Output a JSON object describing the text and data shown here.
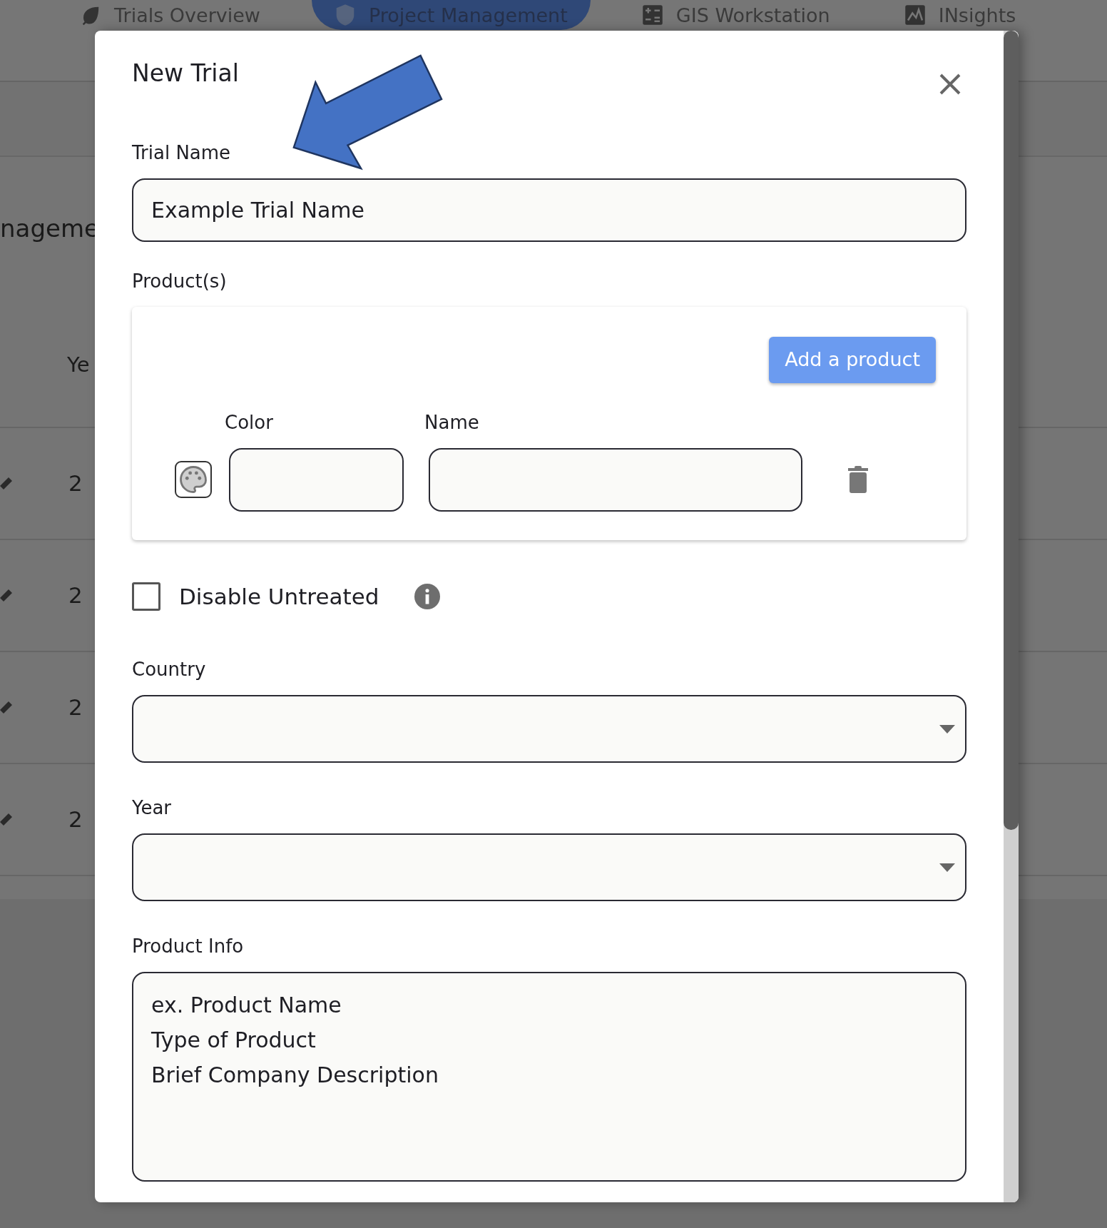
{
  "nav": {
    "tabs": [
      {
        "label": "Trials Overview",
        "selected": false
      },
      {
        "label": "Project Management",
        "selected": true
      },
      {
        "label": "GIS Workstation",
        "selected": false
      },
      {
        "label": "INsights",
        "selected": false
      }
    ]
  },
  "background": {
    "heading": "nageme",
    "column_header": "Ye",
    "rows": [
      {
        "cell": "2"
      },
      {
        "cell": "2"
      },
      {
        "cell": "2"
      },
      {
        "cell": "2"
      }
    ]
  },
  "modal": {
    "title": "New Trial",
    "trial_name": {
      "label": "Trial Name",
      "value": "Example Trial Name"
    },
    "products": {
      "label": "Product(s)",
      "add_button": "Add a product",
      "color_label": "Color",
      "name_label": "Name",
      "rows": [
        {
          "color": "",
          "name": ""
        }
      ]
    },
    "disable_untreated": {
      "label": "Disable Untreated",
      "checked": false
    },
    "country": {
      "label": "Country"
    },
    "year": {
      "label": "Year"
    },
    "product_info": {
      "label": "Product Info",
      "placeholder": "ex. Product Name\nType of Product\nBrief Company Description"
    }
  }
}
